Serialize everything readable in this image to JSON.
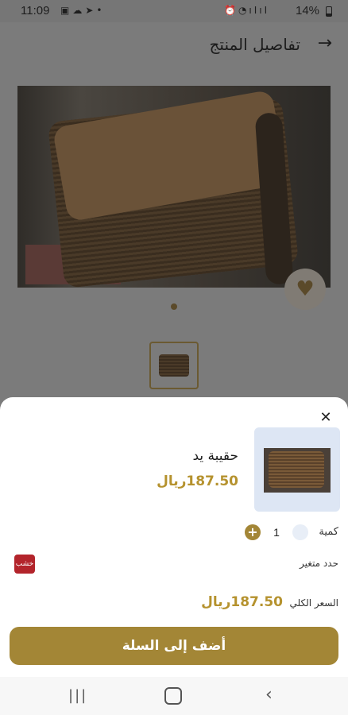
{
  "status_bar": {
    "time": "11:09",
    "battery": "14%"
  },
  "header": {
    "title": "تفاصيل المنتج"
  },
  "sheet": {
    "item_name": "حقيبة يد",
    "item_price": "187.50ريال",
    "quantity_label": "كمية",
    "quantity_value": "1",
    "variant_label": "حدد متغير",
    "variant_chip": "خشب",
    "total_label": "السعر الكلي",
    "total_value": "187.50ريال",
    "add_to_cart": "أضف إلى السلة"
  },
  "colors": {
    "accent": "#a38636",
    "price": "#b5922e",
    "variant_chip": "#b3242b",
    "dim_overlay": "#7b7b7b"
  },
  "icons": {
    "back": "arrow-right-icon",
    "favorite": "heart-icon",
    "close": "close-icon",
    "plus": "plus-icon",
    "minus": "minus-icon"
  }
}
